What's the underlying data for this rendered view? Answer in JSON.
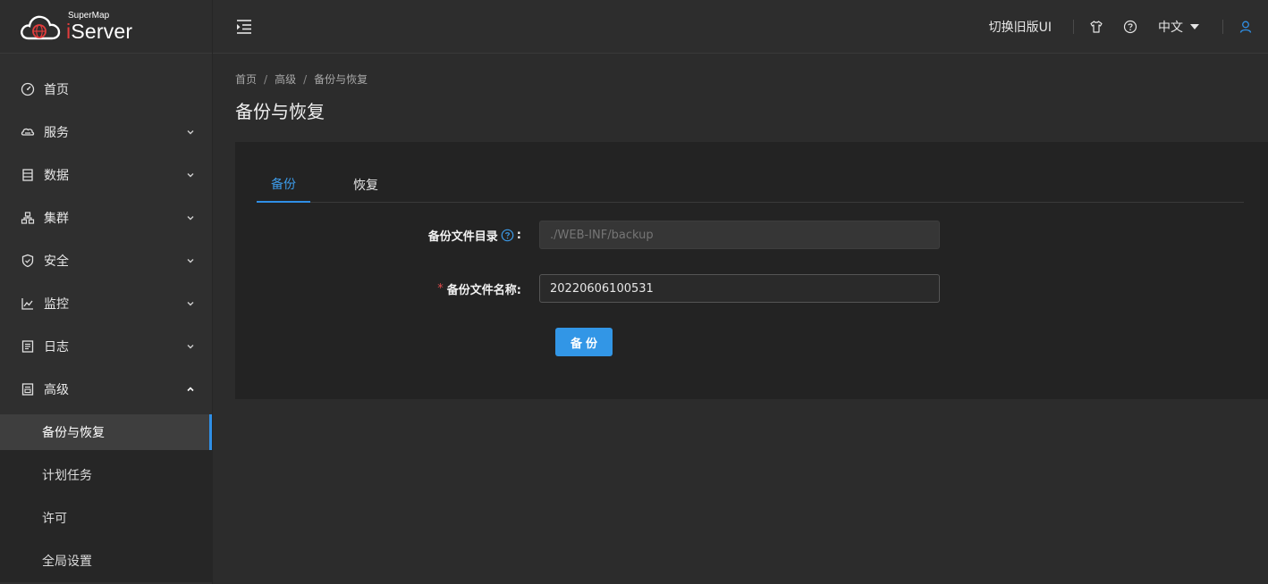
{
  "logo": {
    "small_text": "SuperMap",
    "big_text_i": "i",
    "big_text_rest": "Server"
  },
  "sidebar": {
    "items": [
      {
        "label": "首页",
        "icon": "dashboard-icon"
      },
      {
        "label": "服务",
        "icon": "service-icon"
      },
      {
        "label": "数据",
        "icon": "data-icon"
      },
      {
        "label": "集群",
        "icon": "cluster-icon"
      },
      {
        "label": "安全",
        "icon": "shield-icon"
      },
      {
        "label": "监控",
        "icon": "monitor-chart-icon"
      },
      {
        "label": "日志",
        "icon": "log-icon"
      },
      {
        "label": "高级",
        "icon": "advanced-icon"
      }
    ],
    "subitems": [
      {
        "label": "备份与恢复",
        "active": true
      },
      {
        "label": "计划任务"
      },
      {
        "label": "许可"
      },
      {
        "label": "全局设置"
      }
    ]
  },
  "header": {
    "switch_ui": "切换旧版UI",
    "language": "中文"
  },
  "breadcrumb": {
    "home": "首页",
    "parent": "高级",
    "current": "备份与恢复",
    "separator": "/"
  },
  "page_title": "备份与恢复",
  "tabs": {
    "backup": "备份",
    "restore": "恢复"
  },
  "form": {
    "dir_label": "备份文件目录",
    "dir_colon": ":",
    "dir_placeholder": "./WEB-INF/backup",
    "name_required_mark": "*",
    "name_label": "备份文件名称:",
    "name_value": "20220606100531",
    "submit_label": "备份"
  },
  "colors": {
    "accent": "#2f8fe6",
    "required": "#e04b4b",
    "logo_red": "#e23c3c"
  }
}
